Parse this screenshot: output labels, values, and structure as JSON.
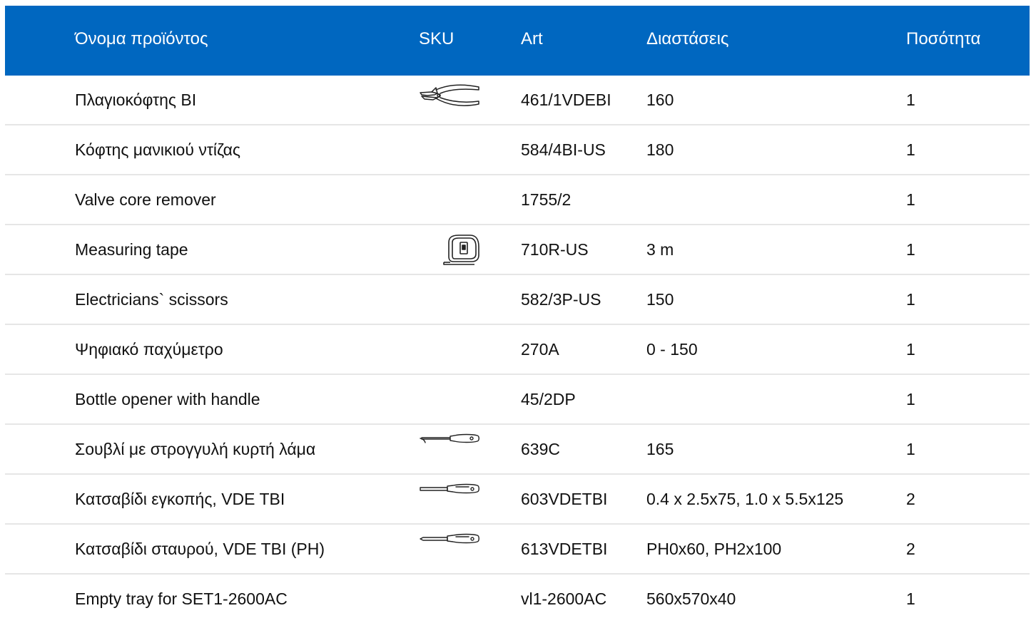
{
  "header": {
    "name": "Όνομα προϊόντος",
    "sku": "SKU",
    "art": "Art",
    "dimensions": "Διαστάσεις",
    "quantity": "Ποσότητα"
  },
  "rows": [
    {
      "name": "Πλαγιοκόφτης BI",
      "sku_icon": "side-cutter-pliers-icon",
      "art": "461/1VDEBI",
      "dimensions": "160",
      "quantity": "1"
    },
    {
      "name": "Κόφτης μανικιού ντίζας",
      "sku_icon": "",
      "art": "584/4BI-US",
      "dimensions": "180",
      "quantity": "1"
    },
    {
      "name": "Valve core remover",
      "sku_icon": "",
      "art": "1755/2",
      "dimensions": "",
      "quantity": "1"
    },
    {
      "name": "Measuring tape",
      "sku_icon": "measuring-tape-icon",
      "art": "710R-US",
      "dimensions": "3 m",
      "quantity": "1"
    },
    {
      "name": "Electricians` scissors",
      "sku_icon": "",
      "art": "582/3P-US",
      "dimensions": "150",
      "quantity": "1"
    },
    {
      "name": "Ψηφιακό παχύμετρο",
      "sku_icon": "",
      "art": "270A",
      "dimensions": "0 - 150",
      "quantity": "1"
    },
    {
      "name": "Bottle opener with handle",
      "sku_icon": "",
      "art": "45/2DP",
      "dimensions": "",
      "quantity": "1"
    },
    {
      "name": "Σουβλί με στρογγυλή κυρτή λάμα",
      "sku_icon": "curved-awl-icon",
      "art": "639C",
      "dimensions": "165",
      "quantity": "1"
    },
    {
      "name": "Κατσαβίδι εγκοπής, VDE TBI",
      "sku_icon": "slotted-screwdriver-icon",
      "art": "603VDETBI",
      "dimensions": "0.4 x 2.5x75, 1.0 x 5.5x125",
      "quantity": "2"
    },
    {
      "name": "Κατσαβίδι σταυρού, VDE TBI (PH)",
      "sku_icon": "phillips-screwdriver-icon",
      "art": "613VDETBI",
      "dimensions": "PH0x60, PH2x100",
      "quantity": "2"
    },
    {
      "name": "Empty tray for SET1-2600AC",
      "sku_icon": "",
      "art": "vl1-2600AC",
      "dimensions": "560x570x40",
      "quantity": "1"
    }
  ],
  "colors": {
    "header_background": "#0067c0",
    "header_text": "#ffffff",
    "row_divider": "#e6e6e6"
  }
}
